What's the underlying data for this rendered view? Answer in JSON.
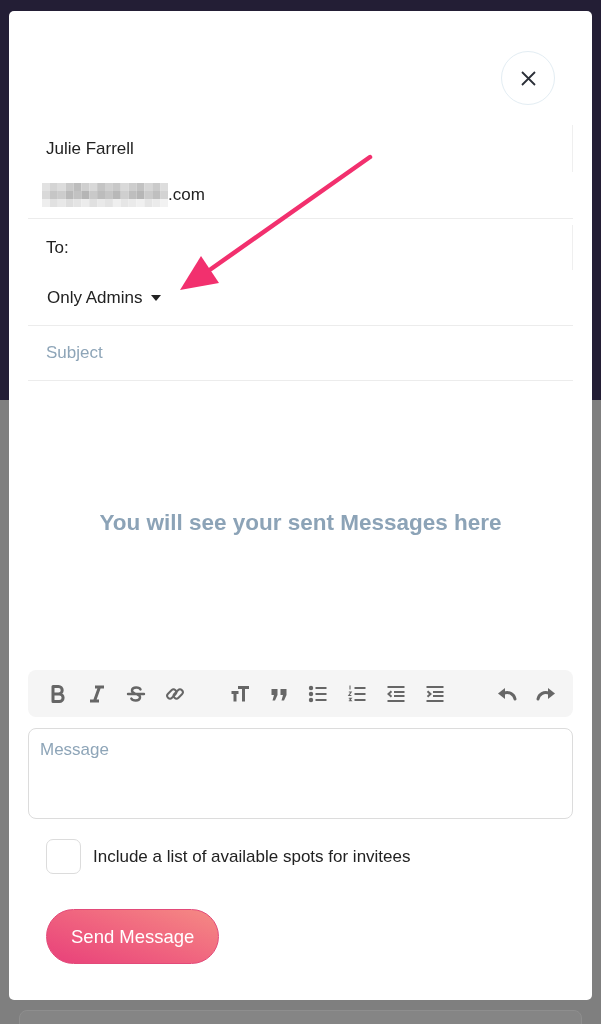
{
  "sender": {
    "name": "Julie Farrell",
    "email": ".com"
  },
  "recipient": {
    "label": "To:",
    "audience": "Only Admins"
  },
  "subject": {
    "placeholder": "Subject"
  },
  "empty_state": {
    "text": "You will see your sent Messages here"
  },
  "toolbar": {
    "groups": [
      [
        {
          "kind": "bold"
        },
        {
          "kind": "italic"
        },
        {
          "kind": "strikethrough"
        },
        {
          "kind": "link"
        }
      ],
      [
        {
          "kind": "text-size"
        },
        {
          "kind": "quote"
        },
        {
          "kind": "bulleted-list"
        },
        {
          "kind": "numbered-list"
        },
        {
          "kind": "outdent"
        },
        {
          "kind": "indent"
        }
      ],
      [
        {
          "kind": "undo"
        },
        {
          "kind": "redo"
        }
      ]
    ]
  },
  "message": {
    "placeholder": "Message"
  },
  "option": {
    "label": "Include a list of available spots for invitees",
    "checked": false
  },
  "send_button": {
    "label": "Send Message"
  }
}
